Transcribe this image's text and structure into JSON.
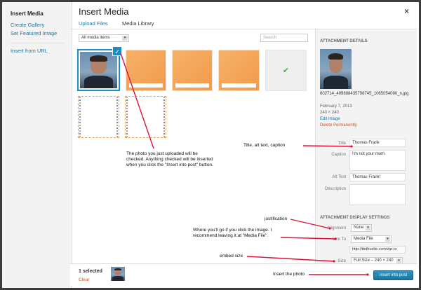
{
  "sidebar": {
    "heading": "Insert Media",
    "links": [
      "Create Gallery",
      "Set Featured Image"
    ],
    "insert_from_url": "Insert from URL"
  },
  "modal": {
    "title": "Insert Media",
    "close": "×",
    "tabs": [
      "Upload Files",
      "Media Library"
    ]
  },
  "toolbar": {
    "filter_value": "All media items",
    "search_placeholder": "Search"
  },
  "details": {
    "section_title": "Attachment Details",
    "filename": "602714_499888435706745_1065054090_n.jpg",
    "date": "February 7, 2013",
    "dimensions": "240 × 240",
    "edit_link": "Edit Image",
    "delete_link": "Delete Permanently",
    "title_label": "Title",
    "title_value": "Thomas Frank",
    "caption_label": "Caption",
    "caption_value": "I'm not your mom.",
    "alt_label": "Alt Text",
    "alt_value": "Thomas Frank!",
    "description_label": "Description",
    "display_section_title": "Attachment Display Settings",
    "alignment_label": "Alignment",
    "alignment_value": "None",
    "link_to_label": "Link To",
    "link_to_value": "Media File",
    "link_url": "http://tbdhustle.com/wp-cc",
    "size_label": "Size",
    "size_value": "Full Size – 240 × 240"
  },
  "bottom": {
    "selected_count": "1 selected",
    "clear": "Clear",
    "insert_button": "Insert into post"
  },
  "annotations": {
    "photo_note": "The photo you just uploaded will be checked. Anything checked will be inserted when you click the \"Insert into post\" button.",
    "fields_note": "Title, alt text, caption",
    "justification": "justification",
    "link_note": "Where you'll go if you click the image. I recommend leaving it at \"Media File\".",
    "embed_size": "embed size",
    "insert_note": "Insert the photo"
  },
  "colors": {
    "accent": "#21759b",
    "primary_button": "#2a95c5",
    "delete": "#d54e21",
    "annotation_line": "#e0103a"
  }
}
